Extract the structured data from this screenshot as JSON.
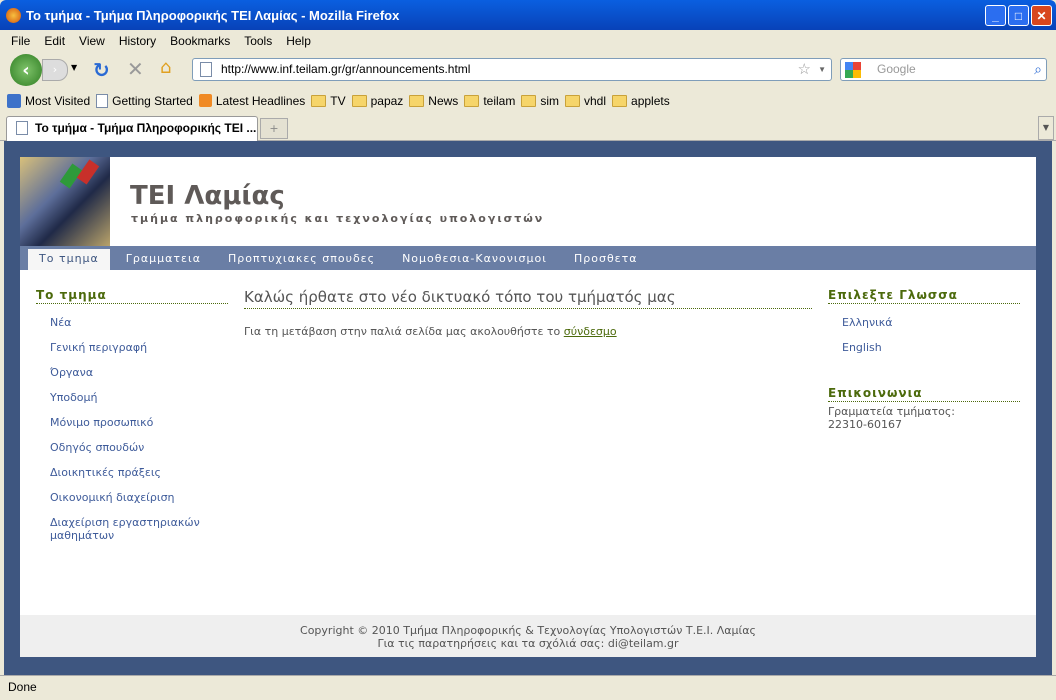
{
  "window": {
    "title": "Το τμήμα - Τμήμα Πληροφορικής ΤΕΙ Λαμίας - Mozilla Firefox"
  },
  "menu": [
    "File",
    "Edit",
    "View",
    "History",
    "Bookmarks",
    "Tools",
    "Help"
  ],
  "toolbar": {
    "url": "http://www.inf.teilam.gr/gr/announcements.html",
    "search_placeholder": "Google"
  },
  "bookmarks": [
    {
      "label": "Most Visited",
      "icon": "most-visited-icon"
    },
    {
      "label": "Getting Started",
      "icon": "page-icon"
    },
    {
      "label": "Latest Headlines",
      "icon": "rss-icon"
    },
    {
      "label": "TV",
      "icon": "folder-icon"
    },
    {
      "label": "papaz",
      "icon": "folder-icon"
    },
    {
      "label": "News",
      "icon": "folder-icon"
    },
    {
      "label": "teilam",
      "icon": "folder-icon"
    },
    {
      "label": "sim",
      "icon": "folder-icon"
    },
    {
      "label": "vhdl",
      "icon": "folder-icon"
    },
    {
      "label": "applets",
      "icon": "folder-icon"
    }
  ],
  "tab": {
    "label": "Το τμήμα - Τμήμα Πληροφορικής ΤΕΙ ..."
  },
  "site": {
    "title": "ΤΕΙ Λαμίας",
    "subtitle": "τμήμα πληροφορικής και τεχνολογίας υπολογιστών",
    "nav": [
      "Το τμημα",
      "Γραμματεια",
      "Προπτυχιακες σπουδες",
      "Νομοθεσια-Κανονισμοι",
      "Προσθετα"
    ],
    "active_nav": 0,
    "left": {
      "heading": "Το τμημα",
      "links": [
        "Νέα",
        "Γενική περιγραφή",
        "Όργανα",
        "Υποδομή",
        "Μόνιμο προσωπικό",
        "Οδηγός σπουδών",
        "Διοικητικές πράξεις",
        "Οικονομική διαχείριση",
        "Διαχείριση εργαστηριακών μαθημάτων"
      ]
    },
    "main": {
      "heading": "Καλώς ήρθατε στο νέο δικτυακό τόπο του τμήματός μας",
      "text": "Για τη μετάβαση στην παλιά σελίδα μας ακολουθήστε το ",
      "link": "σύνδεσμο"
    },
    "right": {
      "lang_heading": "Επιλεξτε Γλωσσα",
      "languages": [
        "Ελληνικά",
        "English"
      ],
      "contact_heading": "Επικοινωνια",
      "contact_line1": "Γραμματεία τμήματος:",
      "contact_line2": "22310-60167"
    },
    "footer": {
      "line1": "Copyright © 2010 Τμήμα Πληροφορικής & Τεχνολογίας Υπολογιστών Τ.Ε.Ι. Λαμίας",
      "line2": "Για τις παρατηρήσεις και τα σχόλιά σας: di@teilam.gr"
    }
  },
  "status": "Done",
  "colors": {
    "titlebar": "#0a5fe0",
    "page_frame": "#3e5680",
    "nav": "#6a7ea5",
    "heading_green": "#4c6a0c",
    "link_blue": "#3e5b9a"
  }
}
